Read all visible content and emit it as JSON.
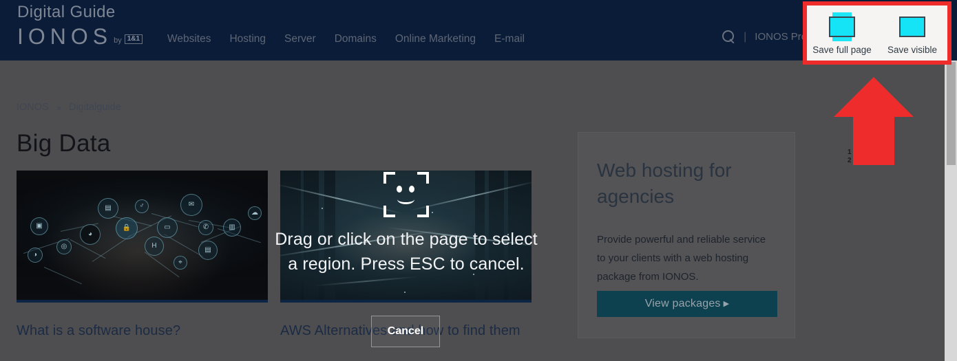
{
  "topnav": {
    "brand_title": "Digital Guide",
    "brand_logo": "IONOS",
    "brand_by": "by",
    "brand_partner": "1&1",
    "menu": [
      {
        "label": "Websites"
      },
      {
        "label": "Hosting"
      },
      {
        "label": "Server"
      },
      {
        "label": "Domains"
      },
      {
        "label": "Online Marketing"
      },
      {
        "label": "E-mail"
      }
    ],
    "search_icon": "search-icon",
    "separator": "|",
    "products_label": "IONOS Products",
    "background_color": "#0b1c38",
    "text_color": "#5e6675"
  },
  "breadcrumb": {
    "items": [
      {
        "label": "IONOS"
      },
      {
        "label": "Digitalguide"
      }
    ],
    "separator": "»"
  },
  "page": {
    "title": "Big Data"
  },
  "cards": [
    {
      "image_name": "network-connections-image",
      "title": "What is a software house?"
    },
    {
      "image_name": "dark-server-corridor-image",
      "title": "AWS Alternatives and how to find them"
    }
  ],
  "promo": {
    "title": "Web hosting for agencies",
    "text": "Provide powerful and reliable service to your clients with a web hosting package from IONOS.",
    "button_label": "View packages",
    "button_caret": "▶",
    "button_color": "#0d414f"
  },
  "overlay": {
    "icon_name": "smiley-viewfinder-icon",
    "message": "Drag or click on the page to select a region. Press ESC to cancel.",
    "cancel_label": "Cancel"
  },
  "extension_popup": {
    "highlight_color": "#ef2c2c",
    "background_color": "#f5f4f2",
    "icon_color": "#15e4f7",
    "buttons": [
      {
        "icon_name": "save-full-page-icon",
        "label": "Save full page"
      },
      {
        "icon_name": "save-visible-icon",
        "label": "Save visible"
      }
    ]
  },
  "annotation": {
    "arrow_name": "red-up-arrow",
    "arrow_color": "#ef2c2c"
  },
  "mini_numbers": {
    "line1": "1",
    "line2": "2"
  }
}
